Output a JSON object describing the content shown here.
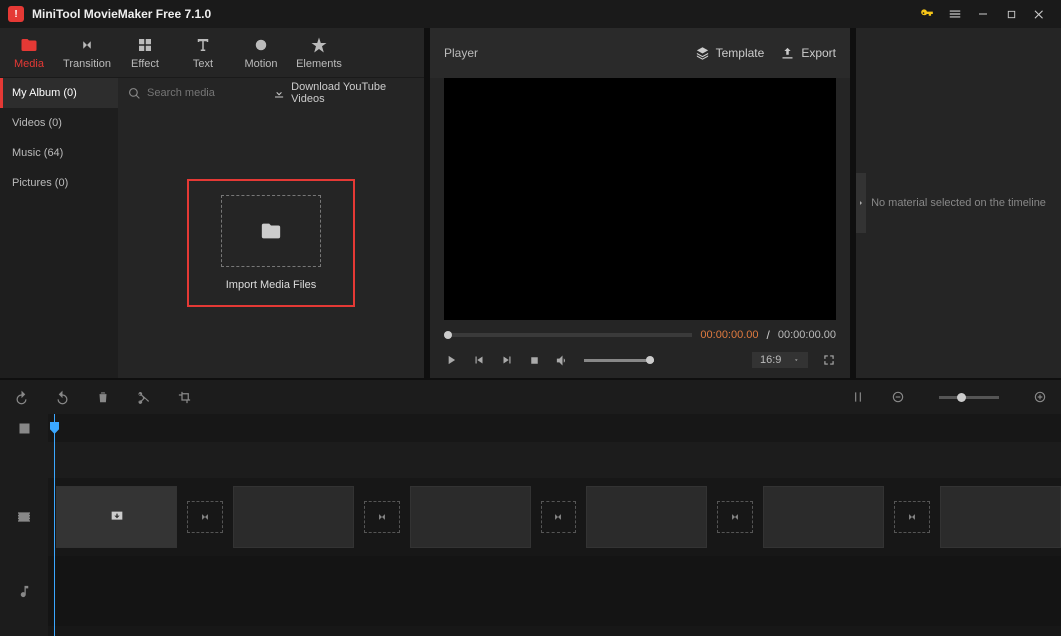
{
  "app": {
    "title": "MiniTool MovieMaker Free 7.1.0"
  },
  "tabs": [
    {
      "label": "Media"
    },
    {
      "label": "Transition"
    },
    {
      "label": "Effect"
    },
    {
      "label": "Text"
    },
    {
      "label": "Motion"
    },
    {
      "label": "Elements"
    }
  ],
  "sidebar": {
    "items": [
      {
        "label": "My Album (0)"
      },
      {
        "label": "Videos (0)"
      },
      {
        "label": "Music (64)"
      },
      {
        "label": "Pictures (0)"
      }
    ]
  },
  "media": {
    "search_placeholder": "Search media",
    "download_label": "Download YouTube Videos",
    "import_label": "Import Media Files"
  },
  "player": {
    "title": "Player",
    "template_label": "Template",
    "export_label": "Export",
    "time_current": "00:00:00.00",
    "time_sep": " / ",
    "time_total": "00:00:00.00",
    "aspect": "16:9"
  },
  "props": {
    "empty_msg": "No material selected on the timeline"
  }
}
